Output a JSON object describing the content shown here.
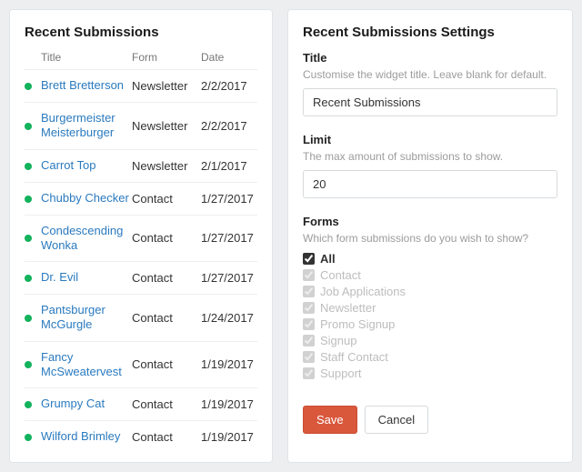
{
  "left": {
    "title": "Recent Submissions",
    "headers": {
      "title": "Title",
      "form": "Form",
      "date": "Date"
    },
    "rows": [
      {
        "title": "Brett Bretterson",
        "form": "Newsletter",
        "date": "2/2/2017"
      },
      {
        "title": "Burgermeister Meisterburger",
        "form": "Newsletter",
        "date": "2/2/2017"
      },
      {
        "title": "Carrot Top",
        "form": "Newsletter",
        "date": "2/1/2017"
      },
      {
        "title": "Chubby Checker",
        "form": "Contact",
        "date": "1/27/2017"
      },
      {
        "title": "Condescending Wonka",
        "form": "Contact",
        "date": "1/27/2017"
      },
      {
        "title": "Dr. Evil",
        "form": "Contact",
        "date": "1/27/2017"
      },
      {
        "title": "Pantsburger McGurgle",
        "form": "Contact",
        "date": "1/24/2017"
      },
      {
        "title": "Fancy McSweatervest",
        "form": "Contact",
        "date": "1/19/2017"
      },
      {
        "title": "Grumpy Cat",
        "form": "Contact",
        "date": "1/19/2017"
      },
      {
        "title": "Wilford Brimley",
        "form": "Contact",
        "date": "1/19/2017"
      }
    ]
  },
  "right": {
    "title": "Recent Submissions Settings",
    "title_section": {
      "label": "Title",
      "help": "Customise the widget title. Leave blank for default.",
      "value": "Recent Submissions"
    },
    "limit_section": {
      "label": "Limit",
      "help": "The max amount of submissions to show.",
      "value": "20"
    },
    "forms_section": {
      "label": "Forms",
      "help": "Which form submissions do you wish to show?",
      "options": [
        {
          "label": "All",
          "checked": true,
          "bold": true,
          "muted": false
        },
        {
          "label": "Contact",
          "checked": true,
          "bold": false,
          "muted": true
        },
        {
          "label": "Job Applications",
          "checked": true,
          "bold": false,
          "muted": true
        },
        {
          "label": "Newsletter",
          "checked": true,
          "bold": false,
          "muted": true
        },
        {
          "label": "Promo Signup",
          "checked": true,
          "bold": false,
          "muted": true
        },
        {
          "label": "Signup",
          "checked": true,
          "bold": false,
          "muted": true
        },
        {
          "label": "Staff Contact",
          "checked": true,
          "bold": false,
          "muted": true
        },
        {
          "label": "Support",
          "checked": true,
          "bold": false,
          "muted": true
        }
      ]
    },
    "buttons": {
      "save": "Save",
      "cancel": "Cancel"
    }
  }
}
